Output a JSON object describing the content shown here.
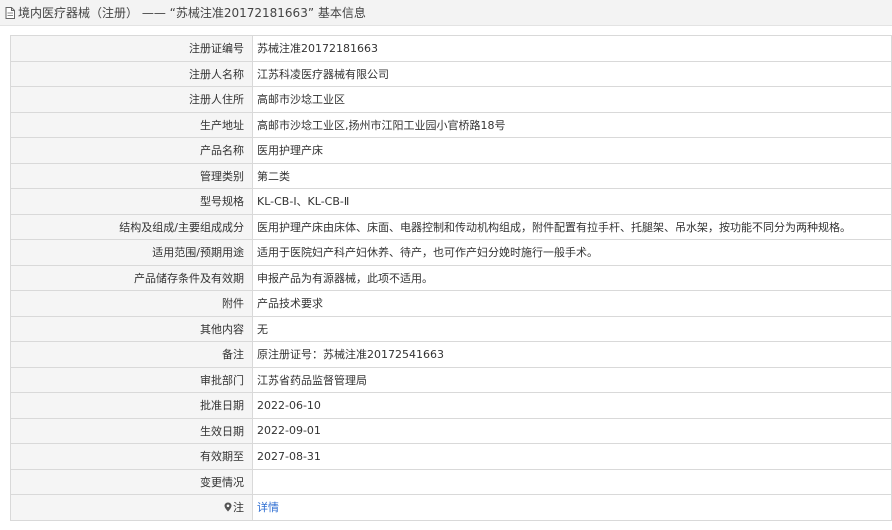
{
  "header": {
    "title": "境内医疗器械（注册） —— “苏械注准20172181663” 基本信息"
  },
  "rows": [
    {
      "label": "注册证编号",
      "value": "苏械注准20172181663"
    },
    {
      "label": "注册人名称",
      "value": "江苏科凌医疗器械有限公司"
    },
    {
      "label": "注册人住所",
      "value": "高邮市沙埝工业区"
    },
    {
      "label": "生产地址",
      "value": "高邮市沙埝工业区,扬州市江阳工业园小官桥路18号"
    },
    {
      "label": "产品名称",
      "value": "医用护理产床"
    },
    {
      "label": "管理类别",
      "value": "第二类"
    },
    {
      "label": "型号规格",
      "value": "KL-CB-Ⅰ、KL-CB-Ⅱ"
    },
    {
      "label": "结构及组成/主要组成成分",
      "value": "医用护理产床由床体、床面、电器控制和传动机构组成，附件配置有拉手杆、托腿架、吊水架，按功能不同分为两种规格。"
    },
    {
      "label": "适用范围/预期用途",
      "value": "适用于医院妇产科产妇休养、待产，也可作产妇分娩时施行一般手术。"
    },
    {
      "label": "产品储存条件及有效期",
      "value": "申报产品为有源器械，此项不适用。"
    },
    {
      "label": "附件",
      "value": "产品技术要求"
    },
    {
      "label": "其他内容",
      "value": "无"
    },
    {
      "label": "备注",
      "value": "原注册证号：苏械注准20172541663"
    },
    {
      "label": "审批部门",
      "value": "江苏省药品监督管理局"
    },
    {
      "label": "批准日期",
      "value": "2022-06-10"
    },
    {
      "label": "生效日期",
      "value": "2022-09-01"
    },
    {
      "label": "有效期至",
      "value": "2027-08-31"
    },
    {
      "label": "变更情况",
      "value": ""
    }
  ],
  "note_row": {
    "label": "注",
    "link_text": "详情"
  },
  "colors": {
    "link": "#2a6bd1",
    "label_bg": "#f5f5f5",
    "border": "#d9d9d9"
  }
}
